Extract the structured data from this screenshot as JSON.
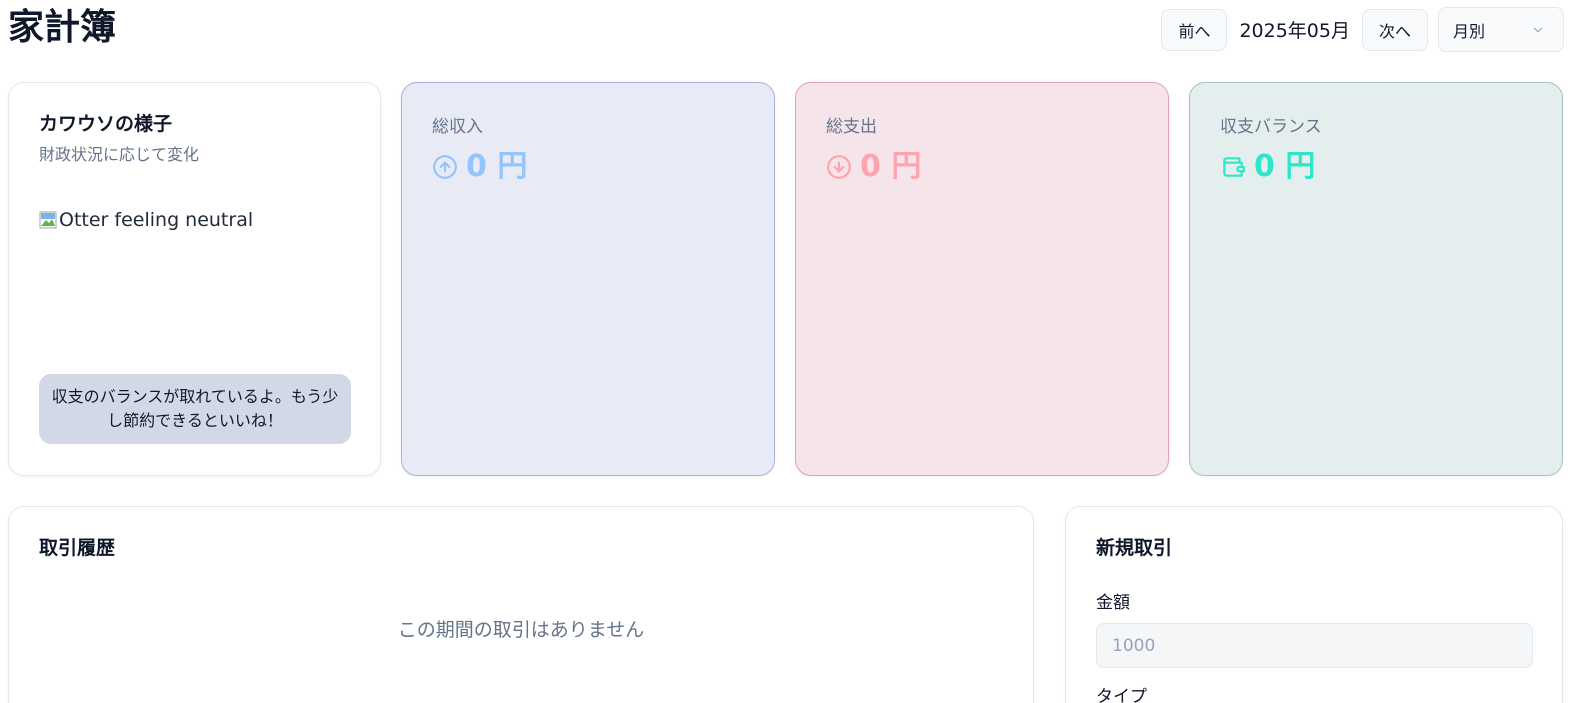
{
  "app": {
    "title": "家計簿"
  },
  "header": {
    "prev_label": "前へ",
    "period": "2025年05月",
    "next_label": "次へ",
    "view_select": "月別"
  },
  "otter": {
    "title": "カワウソの様子",
    "subtitle": "財政状況に応じて変化",
    "image_alt": "Otter feeling neutral",
    "message": "収支のバランスが取れているよ。もう少し節約できるといいね！"
  },
  "stats": {
    "income": {
      "label": "総収入",
      "value": "0 円",
      "color": "#93c5fd",
      "icon": "arrow-up-circle-icon"
    },
    "expense": {
      "label": "総支出",
      "value": "0 円",
      "color": "#fda4af",
      "icon": "arrow-down-circle-icon"
    },
    "balance": {
      "label": "収支バランス",
      "value": "0 円",
      "color": "#2ee6c9",
      "icon": "wallet-icon"
    }
  },
  "history": {
    "title": "取引履歴",
    "empty_message": "この期間の取引はありません"
  },
  "form": {
    "title": "新規取引",
    "amount_label": "金額",
    "amount_placeholder": "1000",
    "type_label": "タイプ"
  }
}
